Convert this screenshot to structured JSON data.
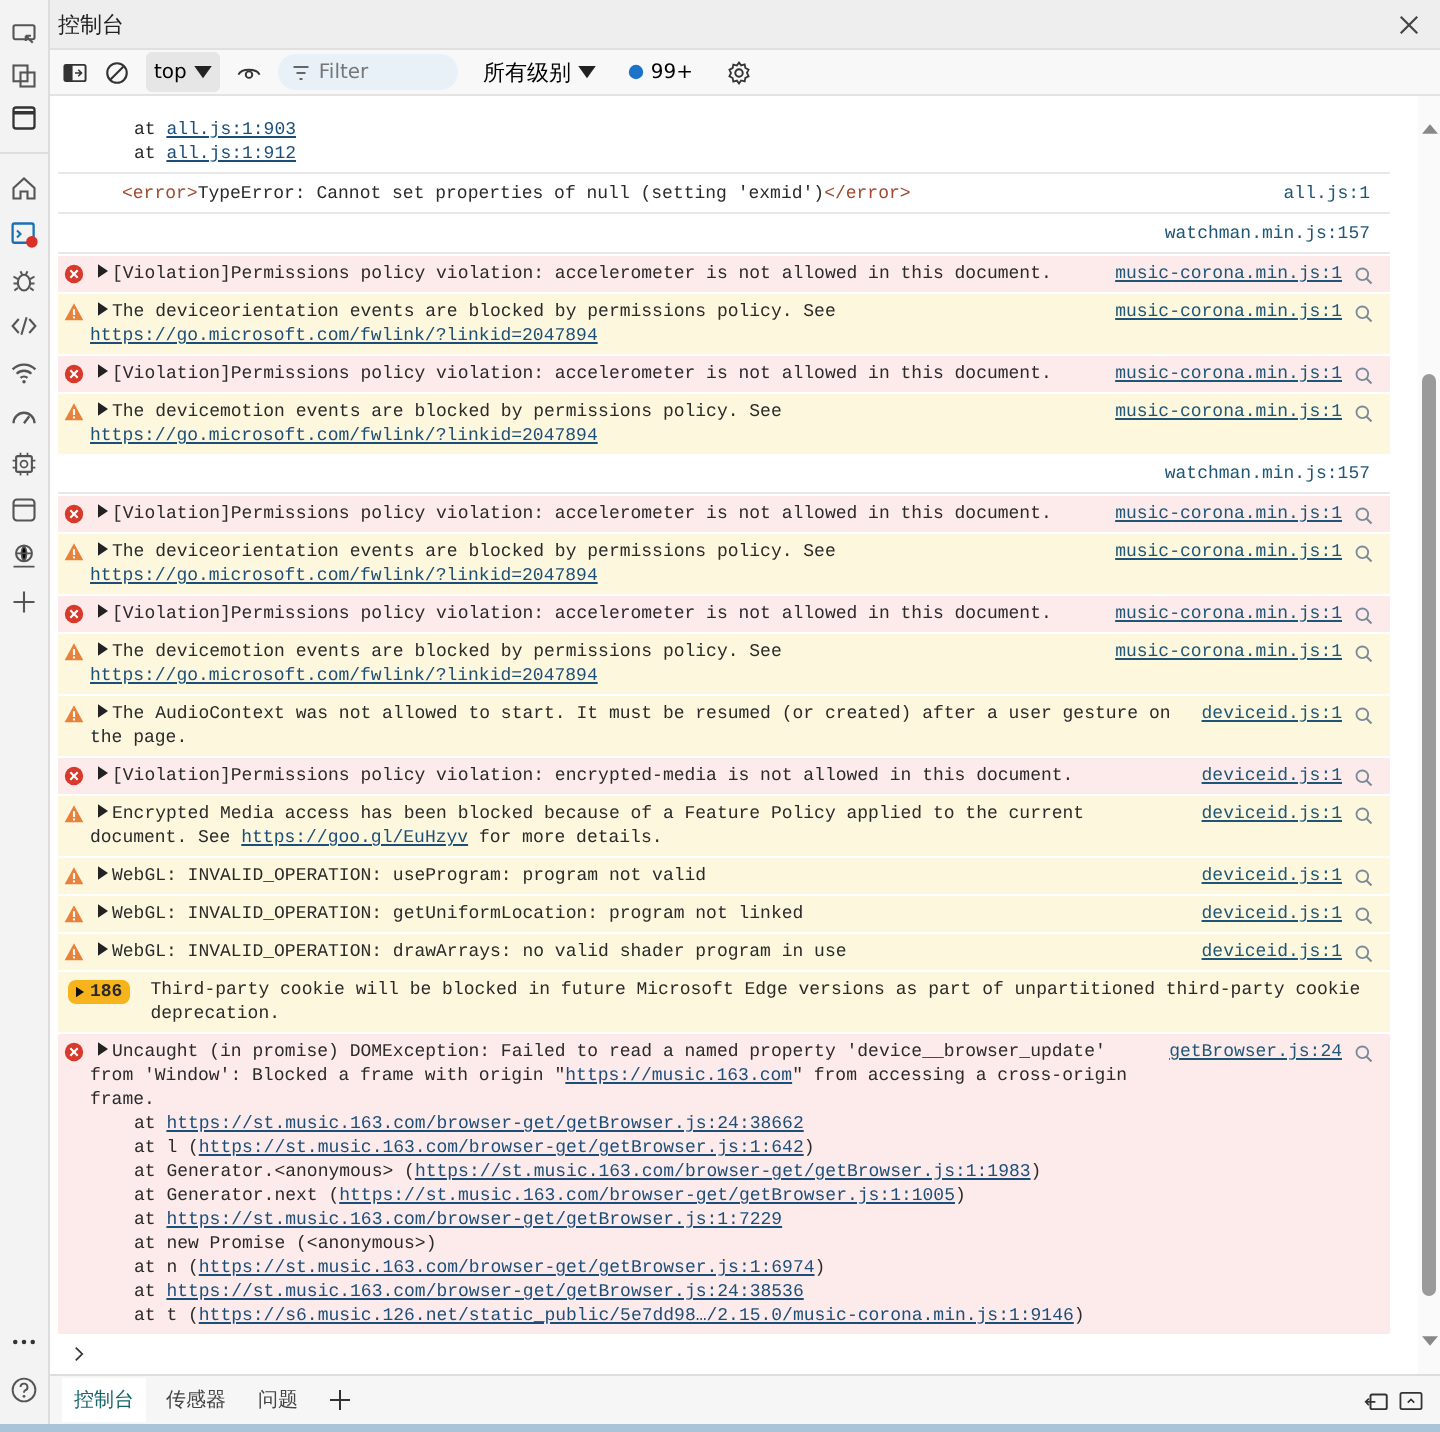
{
  "window": {
    "title": "控制台"
  },
  "toolbar": {
    "context": "top",
    "filter": {
      "placeholder": "Filter"
    },
    "levels": "所有级别",
    "message_count": "99+"
  },
  "console": {
    "messages": [
      {
        "kind": "trace",
        "stack": [
          {
            "prefix": "at ",
            "link": "all.js:1:903"
          },
          {
            "prefix": "at ",
            "link": "all.js:1:912"
          }
        ]
      },
      {
        "kind": "log",
        "parts": [
          {
            "kind": "tag",
            "text": "<error>"
          },
          {
            "kind": "text",
            "text": "TypeError: Cannot set properties of null (setting 'exmid')"
          },
          {
            "kind": "tag",
            "text": "</error>"
          }
        ],
        "source": "all.js:1"
      },
      {
        "kind": "log",
        "source": "watchman.min.js:157"
      },
      {
        "kind": "error",
        "parts": [
          {
            "kind": "text",
            "text": "[Violation]Permissions policy violation: accelerometer is not allowed in this document."
          }
        ],
        "source": "music-corona.min.js:1"
      },
      {
        "kind": "warning",
        "parts": [
          {
            "kind": "text",
            "text": "The deviceorientation events are blocked by permissions policy. See "
          },
          {
            "kind": "link",
            "text": "https://go.microsoft.com/fwlink/?linkid=2047894"
          }
        ],
        "source": "music-corona.min.js:1"
      },
      {
        "kind": "error",
        "parts": [
          {
            "kind": "text",
            "text": "[Violation]Permissions policy violation: accelerometer is not allowed in this document."
          }
        ],
        "source": "music-corona.min.js:1"
      },
      {
        "kind": "warning",
        "parts": [
          {
            "kind": "text",
            "text": "The devicemotion events are blocked by permissions policy. See "
          },
          {
            "kind": "link",
            "text": "https://go.microsoft.com/fwlink/?linkid=2047894"
          }
        ],
        "source": "music-corona.min.js:1"
      },
      {
        "kind": "log",
        "source": "watchman.min.js:157"
      },
      {
        "kind": "error",
        "parts": [
          {
            "kind": "text",
            "text": "[Violation]Permissions policy violation: accelerometer is not allowed in this document."
          }
        ],
        "source": "music-corona.min.js:1"
      },
      {
        "kind": "warning",
        "parts": [
          {
            "kind": "text",
            "text": "The deviceorientation events are blocked by permissions policy. See "
          },
          {
            "kind": "link",
            "text": "https://go.microsoft.com/fwlink/?linkid=2047894"
          }
        ],
        "source": "music-corona.min.js:1"
      },
      {
        "kind": "error",
        "parts": [
          {
            "kind": "text",
            "text": "[Violation]Permissions policy violation: accelerometer is not allowed in this document."
          }
        ],
        "source": "music-corona.min.js:1"
      },
      {
        "kind": "warning",
        "parts": [
          {
            "kind": "text",
            "text": "The devicemotion events are blocked by permissions policy. See "
          },
          {
            "kind": "link",
            "text": "https://go.microsoft.com/fwlink/?linkid=2047894"
          }
        ],
        "source": "music-corona.min.js:1"
      },
      {
        "kind": "warning",
        "parts": [
          {
            "kind": "text",
            "text": "The AudioContext was not allowed to start. It must be resumed (or created) after a user gesture on the page."
          }
        ],
        "source": "deviceid.js:1"
      },
      {
        "kind": "error",
        "parts": [
          {
            "kind": "text",
            "text": "[Violation]Permissions policy violation: encrypted-media is not allowed in this document."
          }
        ],
        "source": "deviceid.js:1"
      },
      {
        "kind": "warning",
        "parts": [
          {
            "kind": "text",
            "text": "Encrypted Media access has been blocked because of a Feature Policy applied to the current document. See "
          },
          {
            "kind": "link",
            "text": "https://goo.gl/EuHzyv"
          },
          {
            "kind": "text",
            "text": " for more details."
          }
        ],
        "source": "deviceid.js:1"
      },
      {
        "kind": "warning",
        "parts": [
          {
            "kind": "text",
            "text": "WebGL: INVALID_OPERATION: useProgram: program not valid"
          }
        ],
        "source": "deviceid.js:1"
      },
      {
        "kind": "warning",
        "parts": [
          {
            "kind": "text",
            "text": "WebGL: INVALID_OPERATION: getUniformLocation: program not linked"
          }
        ],
        "source": "deviceid.js:1"
      },
      {
        "kind": "warning",
        "parts": [
          {
            "kind": "text",
            "text": "WebGL: INVALID_OPERATION: drawArrays: no valid shader program in use"
          }
        ],
        "source": "deviceid.js:1"
      },
      {
        "kind": "issue",
        "count": "186",
        "parts": [
          {
            "kind": "text",
            "text": "Third-party cookie will be blocked in future Microsoft Edge versions as part of unpartitioned third-party cookie deprecation."
          }
        ]
      },
      {
        "kind": "error",
        "parts": [
          {
            "kind": "text",
            "text": "Uncaught (in promise) DOMException: Failed to read a named property 'device__browser_update' from 'Window': Blocked a frame with origin \""
          },
          {
            "kind": "link",
            "text": "https://music.163.com"
          },
          {
            "kind": "text",
            "text": "\" from accessing a cross-origin frame."
          }
        ],
        "source": "getBrowser.js:24",
        "stack": [
          {
            "prefix": "at ",
            "link": "https://st.music.163.com/browser-get/getBrowser.js:24:38662"
          },
          {
            "prefix": "at l (",
            "link": "https://st.music.163.com/browser-get/getBrowser.js:1:642",
            "suffix": ")"
          },
          {
            "prefix": "at Generator.<anonymous> (",
            "link": "https://st.music.163.com/browser-get/getBrowser.js:1:1983",
            "suffix": ")"
          },
          {
            "prefix": "at Generator.next (",
            "link": "https://st.music.163.com/browser-get/getBrowser.js:1:1005",
            "suffix": ")"
          },
          {
            "prefix": "at ",
            "link": "https://st.music.163.com/browser-get/getBrowser.js:1:7229"
          },
          {
            "prefix": "at new Promise (<anonymous>)"
          },
          {
            "prefix": "at n (",
            "link": "https://st.music.163.com/browser-get/getBrowser.js:1:6974",
            "suffix": ")"
          },
          {
            "prefix": "at ",
            "link": "https://st.music.163.com/browser-get/getBrowser.js:24:38536"
          },
          {
            "prefix": "at t (",
            "link": "https://s6.music.126.net/static_public/5e7dd98…/2.15.0/music-corona.min.js:1:9146",
            "suffix": ")"
          }
        ]
      }
    ]
  },
  "tabs": [
    {
      "label": "控制台",
      "selected": true
    },
    {
      "label": "传感器",
      "selected": false
    },
    {
      "label": "问题",
      "selected": false
    }
  ]
}
